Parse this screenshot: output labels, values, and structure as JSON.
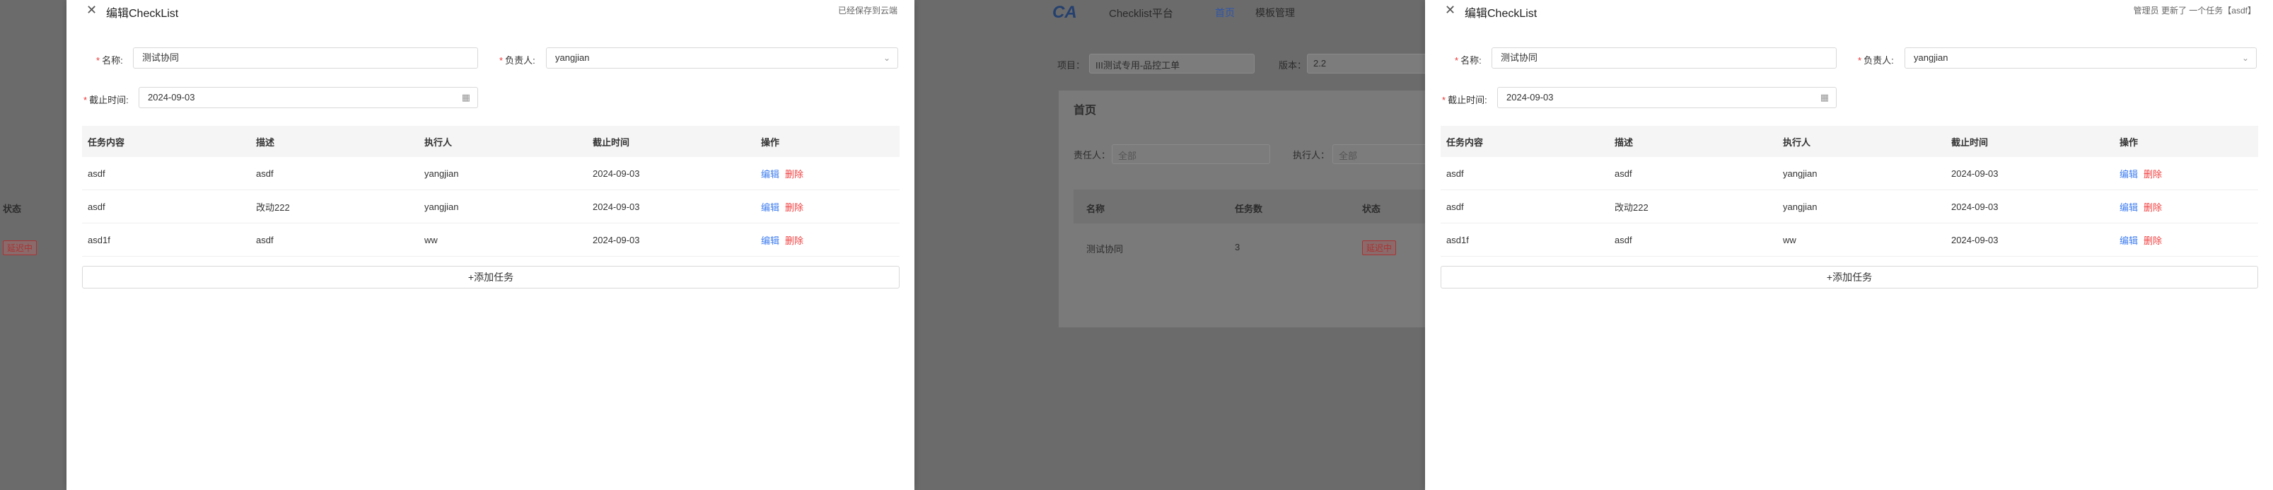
{
  "background": {
    "logo": "CA",
    "app_title": "Checklist平台",
    "nav_home": "首页",
    "nav_templates": "模板管理",
    "project_label": "项目：",
    "project_value": "III测试专用-品控工单",
    "version_label": "版本：",
    "version_value": "2.2",
    "section_title": "首页",
    "owner_label": "责任人：",
    "owner_placeholder": "全部",
    "executor_label": "执行人：",
    "executor_placeholder": "全部",
    "table_headers": [
      "名称",
      "任务数",
      "状态"
    ],
    "row": {
      "name": "测试协同",
      "count": "3",
      "status": "延迟中"
    },
    "left_status_header": "状态",
    "left_status_tag": "延迟中"
  },
  "drawers": [
    {
      "title": "编辑CheckList",
      "status": "已经保存到云端",
      "name_label": "名称:",
      "name_value": "测试协同",
      "owner_label": "负责人:",
      "owner_value": "yangjian",
      "deadline_label": "截止时间:",
      "deadline_value": "2024-09-03",
      "columns": [
        "任务内容",
        "描述",
        "执行人",
        "截止时间",
        "操作"
      ],
      "rows": [
        {
          "content": "asdf",
          "desc": "asdf",
          "executor": "yangjian",
          "deadline": "2024-09-03",
          "edit": "编辑",
          "del": "删除"
        },
        {
          "content": "asdf",
          "desc": "改动222",
          "executor": "yangjian",
          "deadline": "2024-09-03",
          "edit": "编辑",
          "del": "删除"
        },
        {
          "content": "asd1f",
          "desc": "asdf",
          "executor": "ww",
          "deadline": "2024-09-03",
          "edit": "编辑",
          "del": "删除"
        }
      ],
      "add_label": "+添加任务"
    },
    {
      "title": "编辑CheckList",
      "status": "管理员 更新了 一个任务【asdf】",
      "name_label": "名称:",
      "name_value": "测试协同",
      "owner_label": "负责人:",
      "owner_value": "yangjian",
      "deadline_label": "截止时间:",
      "deadline_value": "2024-09-03",
      "columns": [
        "任务内容",
        "描述",
        "执行人",
        "截止时间",
        "操作"
      ],
      "rows": [
        {
          "content": "asdf",
          "desc": "asdf",
          "executor": "yangjian",
          "deadline": "2024-09-03",
          "edit": "编辑",
          "del": "删除"
        },
        {
          "content": "asdf",
          "desc": "改动222",
          "executor": "yangjian",
          "deadline": "2024-09-03",
          "edit": "编辑",
          "del": "删除"
        },
        {
          "content": "asd1f",
          "desc": "asdf",
          "executor": "ww",
          "deadline": "2024-09-03",
          "edit": "编辑",
          "del": "删除"
        }
      ],
      "add_label": "+添加任务"
    }
  ]
}
